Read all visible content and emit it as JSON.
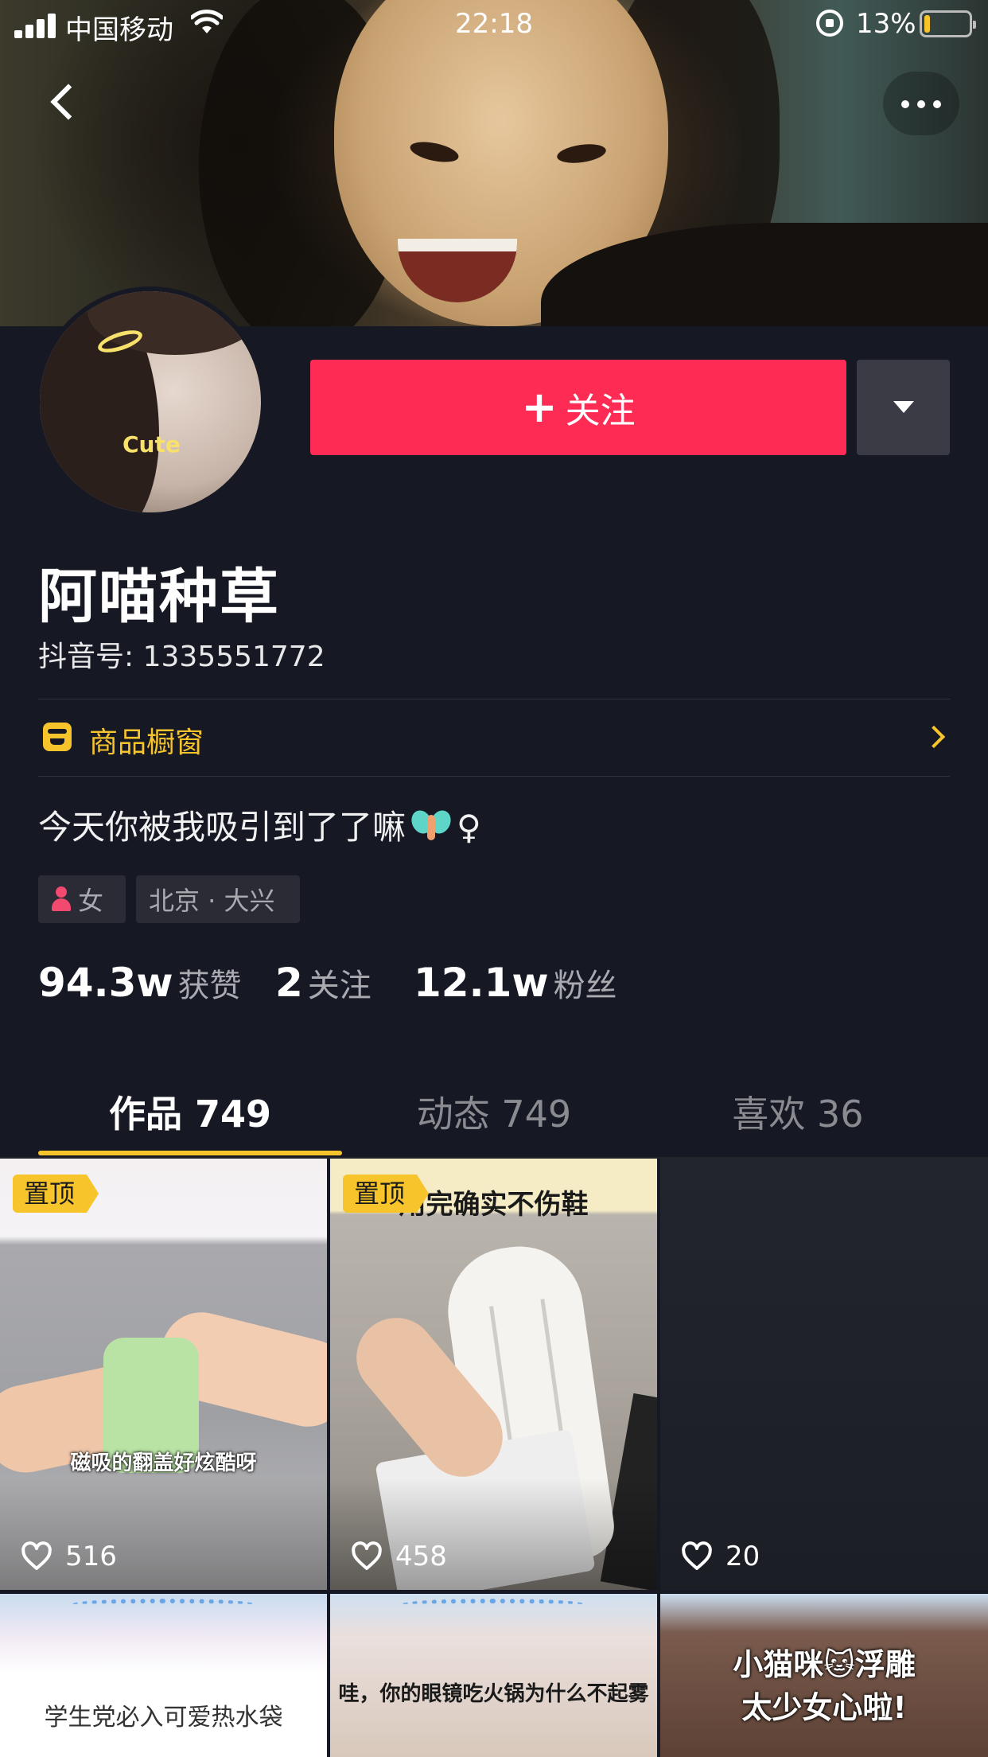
{
  "status_bar": {
    "carrier": "中国移动",
    "time": "22:18",
    "battery_percent": "13%",
    "battery_level": 0.13
  },
  "profile": {
    "avatar_sticker_text": "Cute",
    "follow_label": "关注",
    "nickname": "阿喵种草",
    "douyin_id": "抖音号: 1335551772",
    "shop_window_label": "商品橱窗",
    "bio": "今天你被我吸引到了了嘛",
    "bio_suffix": "♀",
    "tags": {
      "gender": "女",
      "location": "北京 · 大兴"
    },
    "stats": {
      "likes_value": "94.3w",
      "likes_label": "获赞",
      "following_value": "2",
      "following_label": "关注",
      "followers_value": "12.1w",
      "followers_label": "粉丝"
    }
  },
  "tabs": [
    {
      "label": "作品 749",
      "active": true
    },
    {
      "label": "动态 749",
      "active": false
    },
    {
      "label": "喜欢 36",
      "active": false
    }
  ],
  "videos": [
    {
      "pinned_label": "置顶",
      "likes": "516",
      "caption": "磁吸的翻盖好炫酷呀"
    },
    {
      "pinned_label": "置顶",
      "likes": "458",
      "caption": "用完确实不伤鞋"
    },
    {
      "likes": "20"
    },
    {
      "caption": "学生党必入可爱热水袋"
    },
    {
      "caption": "哇，你的眼镜吃火锅为什么不起雾"
    },
    {
      "caption_line1": "小猫咪🐱浮雕",
      "caption_line2": "太少女心啦!"
    }
  ],
  "colors": {
    "background": "#161823",
    "follow_button": "#fe2c55",
    "accent_yellow": "#f7c42c"
  },
  "icons": {
    "back": "chevron-left",
    "more": "ellipsis",
    "shop": "shop-window",
    "like": "heart-outline",
    "gender": "female"
  }
}
